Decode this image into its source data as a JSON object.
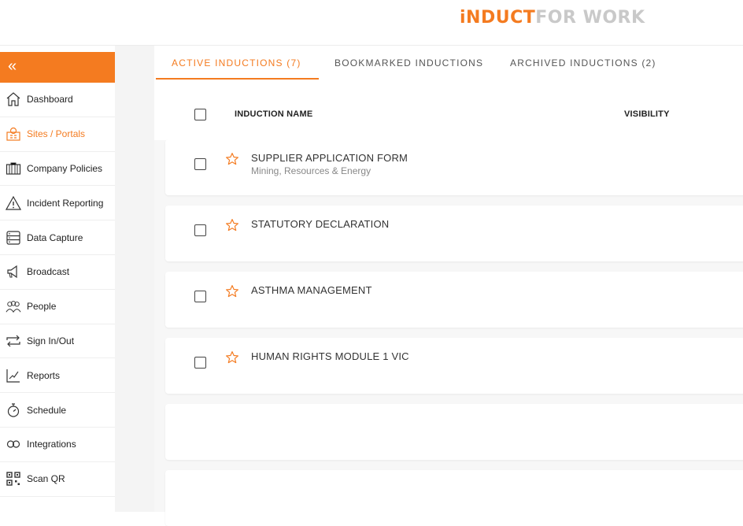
{
  "header": {
    "logo_part1": "iNDUCT",
    "logo_part2": "FOR WORK"
  },
  "sidebar": {
    "collapse_label": "«",
    "items": [
      {
        "label": "Dashboard",
        "icon": "house-icon",
        "active": false
      },
      {
        "label": "Sites / Portals",
        "icon": "sites-icon",
        "active": true
      },
      {
        "label": "Company Policies",
        "icon": "briefcase-icon",
        "active": false
      },
      {
        "label": "Incident Reporting",
        "icon": "warning-icon",
        "active": false
      },
      {
        "label": "Data Capture",
        "icon": "server-icon",
        "active": false
      },
      {
        "label": "Broadcast",
        "icon": "megaphone-icon",
        "active": false
      },
      {
        "label": "People",
        "icon": "people-icon",
        "active": false
      },
      {
        "label": "Sign In/Out",
        "icon": "arrows-icon",
        "active": false
      },
      {
        "label": "Reports",
        "icon": "chart-icon",
        "active": false
      },
      {
        "label": "Schedule",
        "icon": "stopwatch-icon",
        "active": false
      },
      {
        "label": "Integrations",
        "icon": "link-icon",
        "active": false
      },
      {
        "label": "Scan QR",
        "icon": "qr-icon",
        "active": false
      }
    ]
  },
  "tabs": [
    {
      "label": "ACTIVE INDUCTIONS (7)",
      "active": true
    },
    {
      "label": "BOOKMARKED INDUCTIONS",
      "active": false
    },
    {
      "label": "ARCHIVED INDUCTIONS (2)",
      "active": false
    }
  ],
  "table": {
    "col_name": "INDUCTION NAME",
    "col_visibility": "VISIBILITY",
    "rows": [
      {
        "title": "SUPPLIER APPLICATION FORM",
        "subtitle": "Mining, Resources & Energy"
      },
      {
        "title": "STATUTORY DECLARATION",
        "subtitle": ""
      },
      {
        "title": "ASTHMA MANAGEMENT",
        "subtitle": ""
      },
      {
        "title": "HUMAN RIGHTS MODULE 1 VIC",
        "subtitle": ""
      }
    ]
  },
  "colors": {
    "accent": "#f47b20",
    "logo_grey": "#c9c9c9"
  }
}
